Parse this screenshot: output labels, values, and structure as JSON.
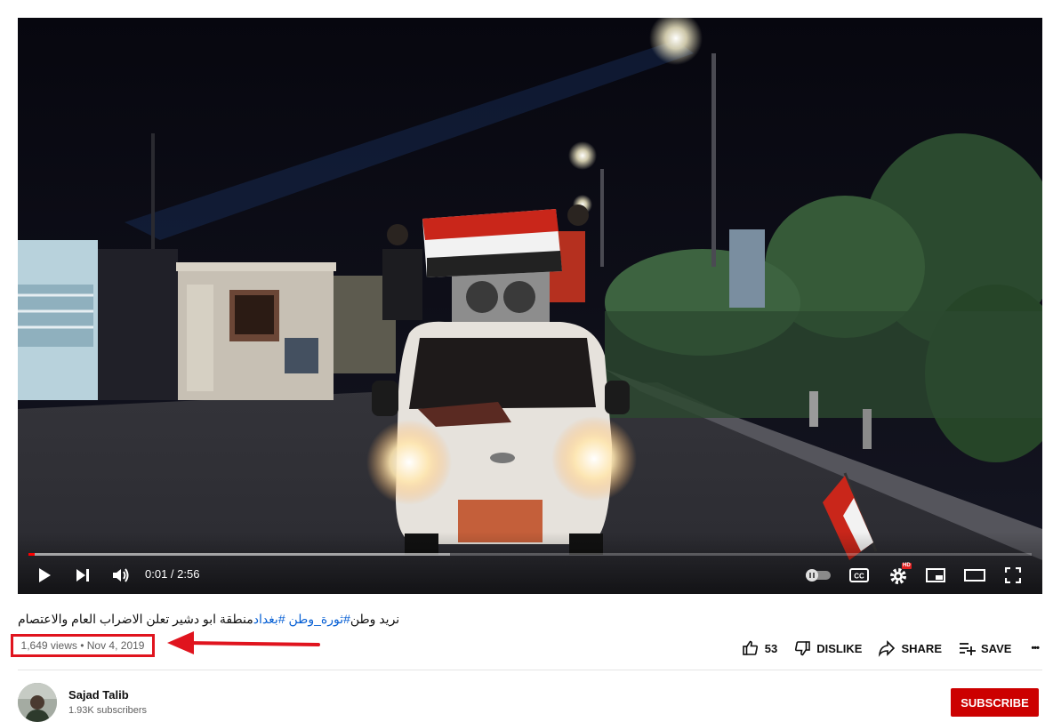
{
  "video": {
    "current_time": "0:01",
    "duration": "2:56",
    "time_display": "0:01 / 2:56",
    "progress_played": 0.006,
    "progress_loaded": 0.42,
    "settings_badge": "HD",
    "player_icons": [
      "play-icon",
      "next-icon",
      "volume-icon",
      "autoplay-toggle-icon",
      "captions-icon",
      "settings-icon",
      "miniplayer-icon",
      "theater-icon",
      "fullscreen-icon"
    ]
  },
  "title": {
    "part1": "نريد وطن",
    "tag1": "#ثورة_وطن",
    "part2": " ",
    "tag2": "#بغداد",
    "part3": "منطقة ابو دشير تعلن الاضراب العام والاعتصام"
  },
  "meta": {
    "text": "1,649 views • Nov 4, 2019",
    "highlight_color": "#e0141e"
  },
  "actions": {
    "like_count": "53",
    "dislike_label": "DISLIKE",
    "share_label": "SHARE",
    "save_label": "SAVE",
    "more_label": "•••"
  },
  "channel": {
    "name": "Sajad Talib",
    "subscribers": "1.93K subscribers",
    "subscribe_label": "SUBSCRIBE",
    "subscribe_color": "#cc0000"
  }
}
